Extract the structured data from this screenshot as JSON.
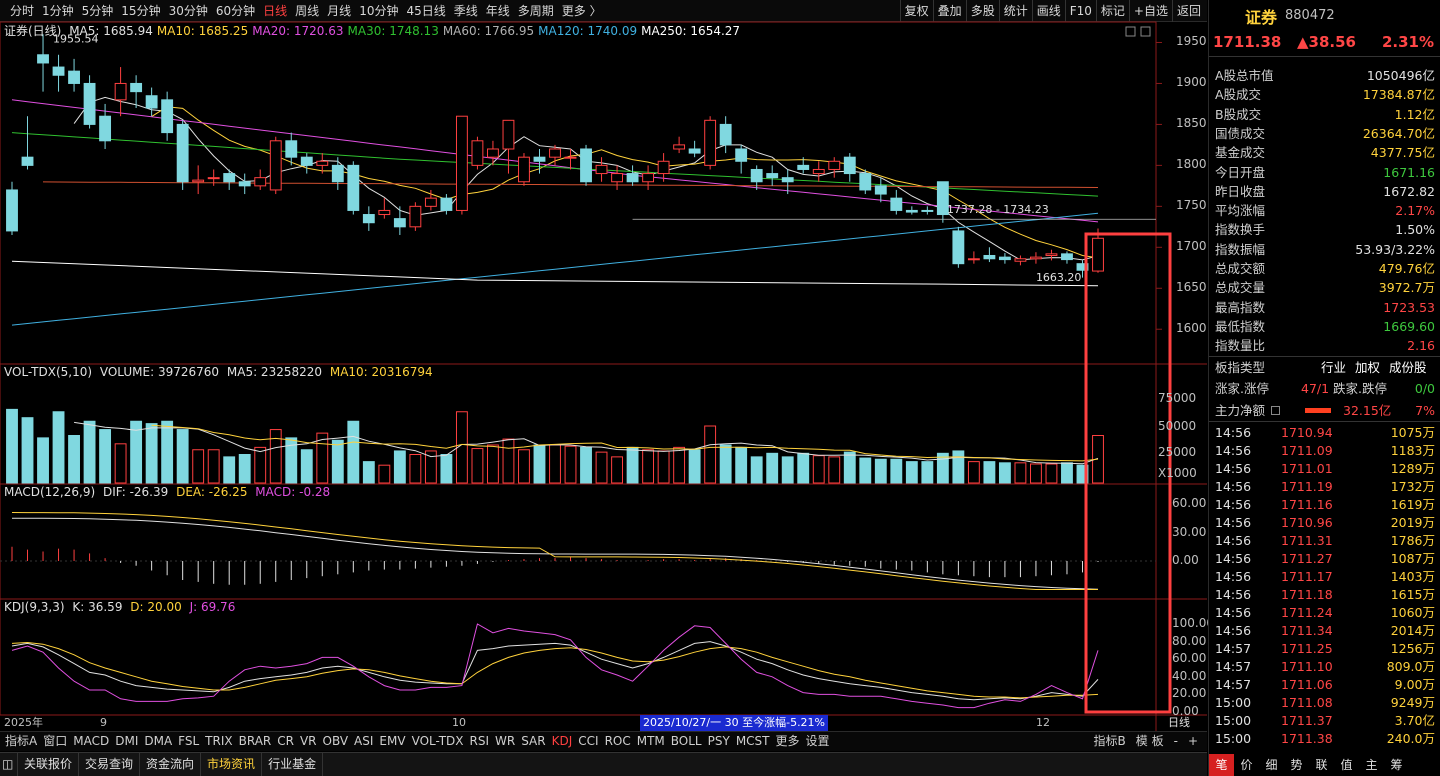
{
  "toolbar": {
    "left": [
      "分时",
      "1分钟",
      "5分钟",
      "15分钟",
      "30分钟",
      "60分钟",
      "日线",
      "周线",
      "月线",
      "10分钟",
      "45日线",
      "季线",
      "年线",
      "多周期",
      "更多 〉"
    ],
    "active": "日线",
    "right": [
      "复权",
      "叠加",
      "多股",
      "统计",
      "画线",
      "F10",
      "标记",
      "+自选",
      "返回"
    ]
  },
  "main_legend": {
    "name": "证券(日线)",
    "items": [
      {
        "label": "MA5: 1685.94",
        "color": "#e0e0e0"
      },
      {
        "label": "MA10: 1685.25",
        "color": "#ffd23c"
      },
      {
        "label": "MA20: 1720.63",
        "color": "#e050e0"
      },
      {
        "label": "MA30: 1748.13",
        "color": "#30c030"
      },
      {
        "label": "MA60: 1766.95",
        "color": "#b0b0b0"
      },
      {
        "label": "MA120: 1740.09",
        "color": "#40b0e0"
      },
      {
        "label": "MA250: 1654.27",
        "color": "#ffffff"
      }
    ]
  },
  "price_axis": [
    "1950",
    "1900",
    "1850",
    "1800",
    "1750",
    "1700",
    "1650",
    "1600"
  ],
  "annotations": {
    "high": "1955.54",
    "range": "1737.28 - 1734.23",
    "low": "1663.20"
  },
  "vol_legend": {
    "name": "VOL-TDX(5,10)",
    "volume": "VOLUME: 39726760",
    "ma5": "MA5: 23258220",
    "ma10": "MA10: 20316794"
  },
  "vol_axis": [
    "75000",
    "50000",
    "25000",
    "X1000"
  ],
  "macd_legend": {
    "name": "MACD(12,26,9)",
    "dif": "DIF: -26.39",
    "dea": "DEA: -26.25",
    "macd": "MACD: -0.28"
  },
  "macd_axis": [
    "60.00",
    "30.00",
    "0.00"
  ],
  "kdj_legend": {
    "name": "KDJ(9,3,3)",
    "k": "K: 36.59",
    "d": "D: 20.00",
    "j": "J: 69.76"
  },
  "kdj_axis": [
    "100.00",
    "80.00",
    "60.00",
    "40.00",
    "20.00",
    "0.00"
  ],
  "date_axis": {
    "labels": [
      "2025年",
      "9",
      "10",
      "12"
    ],
    "range_text": "2025/10/27/一 30 至今涨幅-5.21%",
    "period": "日线"
  },
  "indicator_tabs": [
    "指标A",
    "窗口",
    "MACD",
    "DMI",
    "DMA",
    "FSL",
    "TRIX",
    "BRAR",
    "CR",
    "VR",
    "OBV",
    "ASI",
    "EMV",
    "VOL-TDX",
    "RSI",
    "WR",
    "SAR",
    "KDJ",
    "CCI",
    "ROC",
    "MTM",
    "BOLL",
    "PSY",
    "MCST",
    "更多",
    "设置"
  ],
  "indicator_active": "KDJ",
  "indicator_right": [
    "指标B",
    "模 板",
    "-",
    "+"
  ],
  "bottom_tabs": [
    "关联报价",
    "交易查询",
    "资金流向",
    "市场资讯",
    "行业基金"
  ],
  "bottom_active": "市场资讯",
  "quote": {
    "name": "证券",
    "code": "880472",
    "price": "1711.38",
    "change": "▲38.56",
    "pct": "2.31%"
  },
  "stats": [
    {
      "label": "A股总市值",
      "value": "1050496亿",
      "color": "wht"
    },
    {
      "label": "A股成交",
      "value": "17384.87亿",
      "color": "yel"
    },
    {
      "label": "B股成交",
      "value": "1.12亿",
      "color": "yel"
    },
    {
      "label": "国债成交",
      "value": "26364.70亿",
      "color": "yel"
    },
    {
      "label": "基金成交",
      "value": "4377.75亿",
      "color": "yel"
    },
    {
      "label": "今日开盘",
      "value": "1671.16",
      "color": "grn"
    },
    {
      "label": "昨日收盘",
      "value": "1672.82",
      "color": "wht"
    },
    {
      "label": "平均涨幅",
      "value": "2.17%",
      "color": "red"
    },
    {
      "label": "指数换手",
      "value": "1.50%",
      "color": "wht"
    },
    {
      "label": "指数振幅",
      "value": "53.93/3.22%",
      "color": "wht"
    },
    {
      "label": "总成交额",
      "value": "479.76亿",
      "color": "yel"
    },
    {
      "label": "总成交量",
      "value": "3972.7万",
      "color": "yel"
    },
    {
      "label": "最高指数",
      "value": "1723.53",
      "color": "red"
    },
    {
      "label": "最低指数",
      "value": "1669.60",
      "color": "grn"
    },
    {
      "label": "指数量比",
      "value": "2.16",
      "color": "red"
    }
  ],
  "board": {
    "label": "板指类型",
    "a": "行业",
    "b": "加权",
    "c": "成份股"
  },
  "updown": {
    "label1": "涨家.涨停",
    "v1": "47/1",
    "label2": "跌家.跌停",
    "v2": "0/0"
  },
  "mainflow": {
    "label": "主力净额",
    "value": "32.15亿",
    "pct": "7%"
  },
  "ticks": [
    [
      "14:56",
      "1710.94",
      "1075万"
    ],
    [
      "14:56",
      "1711.09",
      "1183万"
    ],
    [
      "14:56",
      "1711.01",
      "1289万"
    ],
    [
      "14:56",
      "1711.19",
      "1732万"
    ],
    [
      "14:56",
      "1711.16",
      "1619万"
    ],
    [
      "14:56",
      "1710.96",
      "2019万"
    ],
    [
      "14:56",
      "1711.31",
      "1786万"
    ],
    [
      "14:56",
      "1711.27",
      "1087万"
    ],
    [
      "14:56",
      "1711.17",
      "1403万"
    ],
    [
      "14:56",
      "1711.18",
      "1615万"
    ],
    [
      "14:56",
      "1711.24",
      "1060万"
    ],
    [
      "14:56",
      "1711.34",
      "2014万"
    ],
    [
      "14:57",
      "1711.25",
      "1256万"
    ],
    [
      "14:57",
      "1711.10",
      "809.0万"
    ],
    [
      "14:57",
      "1711.06",
      "9.00万"
    ],
    [
      "15:00",
      "1711.08",
      "9249万"
    ],
    [
      "15:00",
      "1711.37",
      "3.70亿"
    ],
    [
      "15:00",
      "1711.38",
      "240.0万"
    ]
  ],
  "side_tabs": [
    "笔",
    "价",
    "细",
    "势",
    "联",
    "值",
    "主",
    "筹"
  ],
  "side_active": "笔",
  "chart_data": {
    "type": "candlestick",
    "symbol": "880472",
    "period": "daily",
    "ylim": [
      1560,
      1975
    ],
    "candles": [
      [
        1770,
        1720,
        1780,
        1715
      ],
      [
        1810,
        1800,
        1860,
        1795
      ],
      [
        1935,
        1925,
        1960,
        1890
      ],
      [
        1920,
        1910,
        1935,
        1890
      ],
      [
        1915,
        1900,
        1930,
        1890
      ],
      [
        1900,
        1850,
        1910,
        1845
      ],
      [
        1860,
        1830,
        1875,
        1820
      ],
      [
        1880,
        1900,
        1920,
        1860
      ],
      [
        1900,
        1890,
        1910,
        1870
      ],
      [
        1885,
        1870,
        1895,
        1860
      ],
      [
        1880,
        1840,
        1890,
        1830
      ],
      [
        1850,
        1780,
        1855,
        1770
      ],
      [
        1780,
        1782,
        1800,
        1765
      ],
      [
        1785,
        1785,
        1795,
        1775
      ],
      [
        1790,
        1780,
        1795,
        1770
      ],
      [
        1780,
        1775,
        1790,
        1765
      ],
      [
        1775,
        1785,
        1795,
        1770
      ],
      [
        1770,
        1830,
        1835,
        1765
      ],
      [
        1830,
        1810,
        1840,
        1800
      ],
      [
        1810,
        1800,
        1815,
        1790
      ],
      [
        1800,
        1805,
        1815,
        1790
      ],
      [
        1800,
        1780,
        1810,
        1770
      ],
      [
        1800,
        1745,
        1805,
        1740
      ],
      [
        1740,
        1730,
        1750,
        1720
      ],
      [
        1740,
        1745,
        1760,
        1735
      ],
      [
        1735,
        1725,
        1750,
        1715
      ],
      [
        1725,
        1750,
        1755,
        1720
      ],
      [
        1750,
        1760,
        1770,
        1745
      ],
      [
        1760,
        1745,
        1765,
        1740
      ],
      [
        1745,
        1860,
        1860,
        1740
      ],
      [
        1800,
        1830,
        1835,
        1795
      ],
      [
        1810,
        1820,
        1830,
        1800
      ],
      [
        1820,
        1855,
        1855,
        1790
      ],
      [
        1780,
        1810,
        1815,
        1775
      ],
      [
        1810,
        1805,
        1820,
        1790
      ],
      [
        1810,
        1820,
        1825,
        1800
      ],
      [
        1810,
        1810,
        1820,
        1795
      ],
      [
        1820,
        1780,
        1825,
        1775
      ],
      [
        1790,
        1800,
        1810,
        1780
      ],
      [
        1780,
        1790,
        1800,
        1770
      ],
      [
        1790,
        1780,
        1800,
        1775
      ],
      [
        1780,
        1790,
        1800,
        1770
      ],
      [
        1790,
        1805,
        1815,
        1780
      ],
      [
        1820,
        1825,
        1835,
        1815
      ],
      [
        1820,
        1815,
        1830,
        1810
      ],
      [
        1800,
        1855,
        1860,
        1795
      ],
      [
        1850,
        1825,
        1860,
        1815
      ],
      [
        1820,
        1805,
        1825,
        1790
      ],
      [
        1795,
        1780,
        1800,
        1770
      ],
      [
        1790,
        1785,
        1800,
        1775
      ],
      [
        1785,
        1780,
        1795,
        1765
      ],
      [
        1800,
        1795,
        1810,
        1790
      ],
      [
        1790,
        1795,
        1805,
        1780
      ],
      [
        1795,
        1805,
        1810,
        1785
      ],
      [
        1810,
        1790,
        1815,
        1780
      ],
      [
        1790,
        1770,
        1795,
        1765
      ],
      [
        1775,
        1765,
        1785,
        1755
      ],
      [
        1760,
        1745,
        1770,
        1740
      ],
      [
        1745,
        1743,
        1750,
        1740
      ],
      [
        1745,
        1744,
        1750,
        1740
      ],
      [
        1780,
        1740,
        1780,
        1730
      ],
      [
        1720,
        1680,
        1725,
        1675
      ],
      [
        1685,
        1686,
        1695,
        1680
      ],
      [
        1690,
        1686,
        1700,
        1682
      ],
      [
        1688,
        1685,
        1693,
        1680
      ],
      [
        1683,
        1686,
        1690,
        1678
      ],
      [
        1686,
        1688,
        1694,
        1680
      ],
      [
        1690,
        1692,
        1697,
        1684
      ],
      [
        1692,
        1685,
        1695,
        1680
      ],
      [
        1680,
        1672,
        1684,
        1663
      ],
      [
        1671,
        1711,
        1723,
        1669
      ]
    ],
    "volume_series": [
      62000,
      55000,
      38000,
      60000,
      40000,
      52000,
      45000,
      33000,
      52000,
      50000,
      52000,
      45000,
      28000,
      28000,
      22000,
      24000,
      30000,
      45000,
      38000,
      28000,
      42000,
      36000,
      52000,
      18000,
      15000,
      27000,
      24000,
      27000,
      24000,
      60000,
      29000,
      32000,
      37000,
      28000,
      32000,
      32000,
      31000,
      30000,
      26000,
      22000,
      30000,
      28000,
      27000,
      30000,
      28000,
      48000,
      32000,
      30000,
      22000,
      25000,
      22000,
      25000,
      23000,
      22000,
      26000,
      21000,
      20000,
      20000,
      18000,
      18000,
      25000,
      27000,
      18000,
      18000,
      17000,
      17000,
      16000,
      16000,
      17000,
      15000,
      40000
    ],
    "macd_hist": [
      15,
      12,
      10,
      13,
      12,
      8,
      3,
      -2,
      -5,
      -10,
      -15,
      -20,
      -22,
      -24,
      -25,
      -25,
      -24,
      -22,
      -20,
      -18,
      -16,
      -14,
      -12,
      -10,
      -9,
      -9,
      -8,
      -7,
      -6,
      -5,
      -3,
      -1,
      1,
      2,
      3,
      3,
      4,
      3,
      2,
      1,
      0,
      1,
      2,
      2,
      1,
      2,
      3,
      2,
      1,
      0,
      -1,
      -2,
      -3,
      -4,
      -5,
      -6,
      -8,
      -9,
      -10,
      -12,
      -14,
      -15,
      -16,
      -17,
      -17,
      -17,
      -16,
      -15,
      -14,
      -12,
      -1
    ],
    "kdj_k": [
      75,
      78,
      74,
      65,
      55,
      45,
      42,
      35,
      30,
      28,
      26,
      25,
      24,
      23,
      28,
      35,
      38,
      40,
      42,
      45,
      50,
      52,
      50,
      45,
      40,
      36,
      34,
      33,
      32,
      32,
      70,
      72,
      75,
      76,
      77,
      78,
      76,
      68,
      60,
      55,
      50,
      55,
      62,
      70,
      78,
      80,
      75,
      68,
      60,
      55,
      48,
      42,
      38,
      35,
      32,
      30,
      28,
      25,
      22,
      20,
      18,
      15,
      14,
      15,
      16,
      15,
      18,
      22,
      20,
      18,
      37
    ],
    "kdj_d": [
      78,
      79,
      77,
      72,
      65,
      56,
      50,
      45,
      40,
      35,
      32,
      29,
      27,
      25,
      25,
      28,
      32,
      36,
      38,
      40,
      44,
      47,
      49,
      48,
      45,
      41,
      38,
      35,
      33,
      32,
      45,
      55,
      62,
      67,
      70,
      72,
      73,
      71,
      67,
      62,
      58,
      57,
      59,
      63,
      68,
      72,
      74,
      72,
      68,
      62,
      57,
      52,
      47,
      43,
      40,
      36,
      33,
      30,
      27,
      24,
      22,
      20,
      18,
      17,
      17,
      16,
      17,
      18,
      19,
      19,
      20
    ],
    "kdj_j": [
      70,
      75,
      68,
      50,
      35,
      25,
      25,
      15,
      12,
      12,
      12,
      15,
      16,
      18,
      35,
      48,
      52,
      50,
      52,
      55,
      62,
      62,
      52,
      40,
      30,
      25,
      25,
      28,
      28,
      30,
      100,
      90,
      95,
      92,
      90,
      88,
      82,
      62,
      48,
      42,
      35,
      52,
      70,
      85,
      98,
      96,
      78,
      60,
      45,
      40,
      30,
      22,
      20,
      20,
      18,
      18,
      18,
      15,
      12,
      10,
      8,
      5,
      5,
      10,
      14,
      12,
      20,
      30,
      22,
      15,
      70
    ]
  }
}
